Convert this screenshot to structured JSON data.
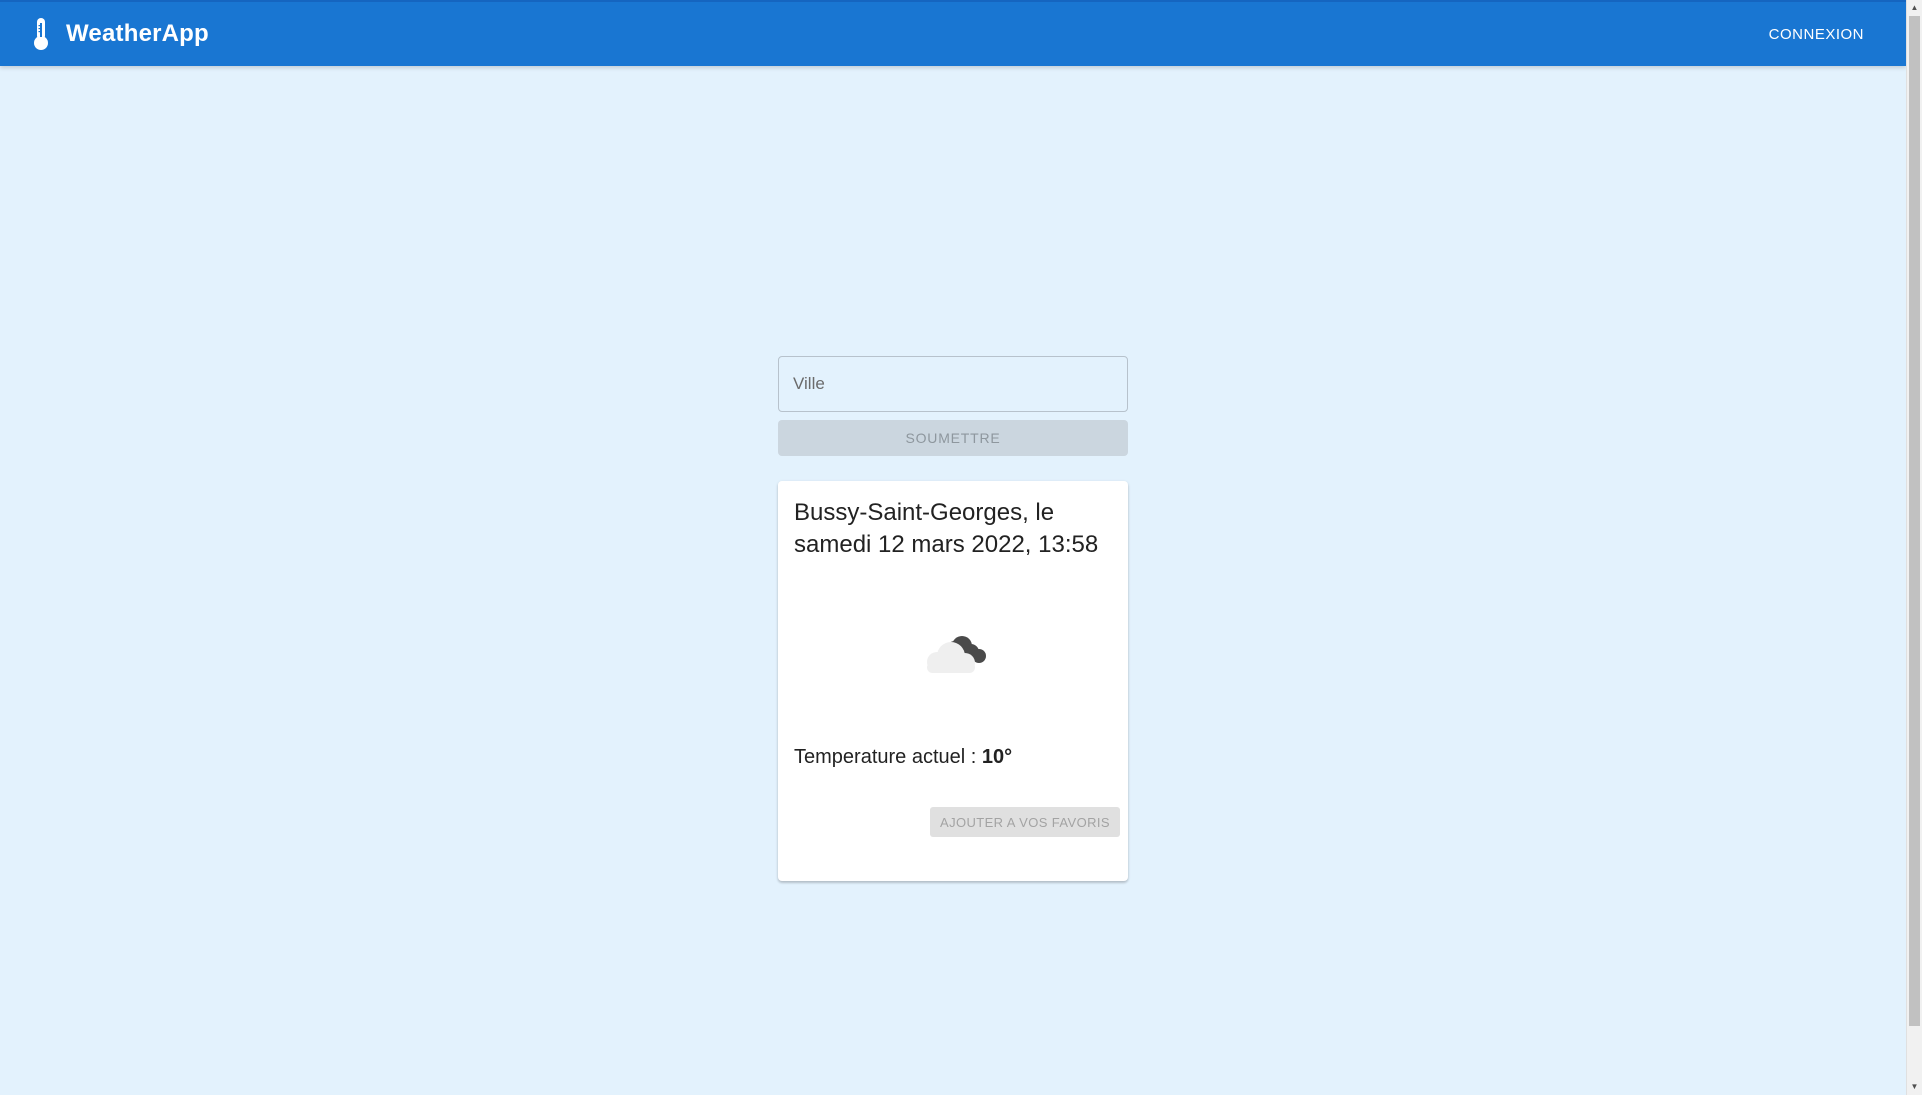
{
  "header": {
    "title": "WeatherApp",
    "login_label": "CONNEXION",
    "brand_icon": "thermometer-icon",
    "bar_color": "#1976d2"
  },
  "search": {
    "placeholder": "Ville",
    "value": "",
    "submit_label": "SOUMETTRE"
  },
  "weather_card": {
    "title": "Bussy-Saint-Georges, le samedi 12 mars 2022, 13:58",
    "icon": "cloudy-icon",
    "temperature_label": "Temperature actuel : ",
    "temperature_value": "10°",
    "favorite_label": "AJOUTER A VOS FAVORIS"
  },
  "colors": {
    "background": "#e3f2fd",
    "primary": "#1976d2"
  }
}
